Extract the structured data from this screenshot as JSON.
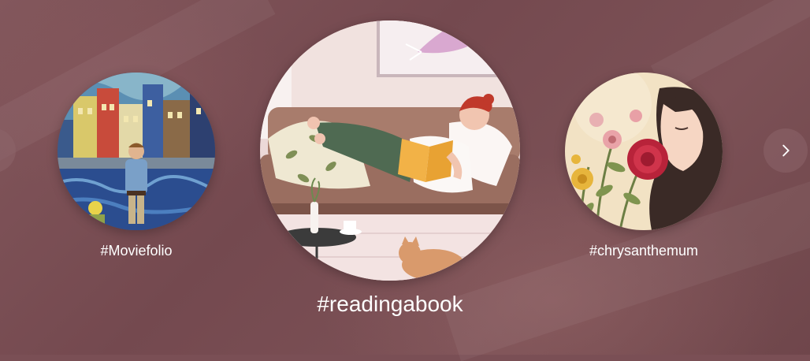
{
  "carousel": {
    "items": [
      {
        "tag": "#Moviefolio",
        "image": "man-in-starry-night-painting"
      },
      {
        "tag": "#readingabook",
        "image": "woman-reading-on-sofa-with-cat"
      },
      {
        "tag": "#chrysanthemum",
        "image": "woman-smelling-flowers"
      }
    ],
    "prev_icon": "chevron-left-icon",
    "next_icon": "chevron-right-icon"
  },
  "colors": {
    "background": "#7a4f55",
    "label_text": "#ffffff"
  }
}
